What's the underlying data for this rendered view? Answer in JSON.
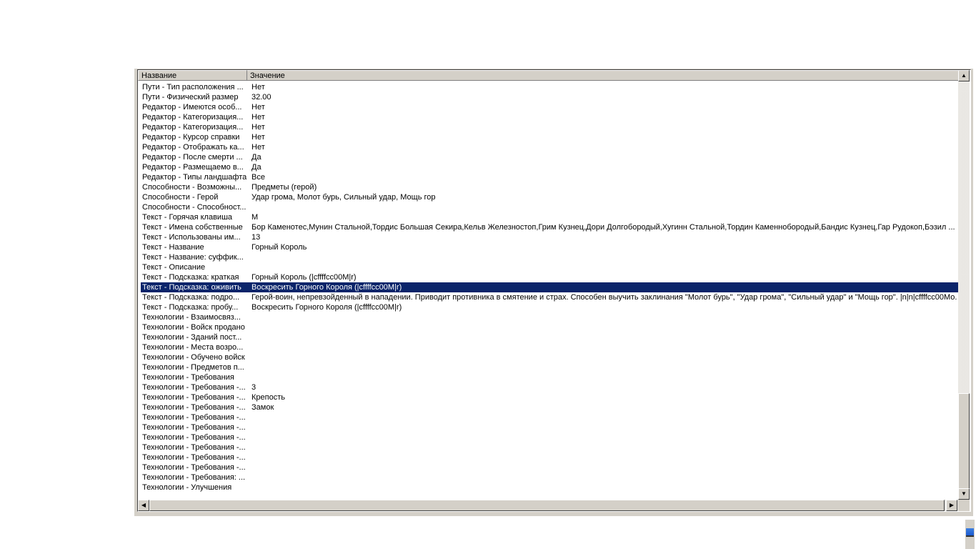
{
  "columns": {
    "name": "Название",
    "value": "Значение"
  },
  "selected_index": 20,
  "rows": [
    {
      "name": "Пути - Тип расположения ...",
      "value": "Нет"
    },
    {
      "name": "Пути - Физический размер",
      "value": "32.00"
    },
    {
      "name": "Редактор - Имеются особ...",
      "value": "Нет"
    },
    {
      "name": "Редактор - Категоризация...",
      "value": "Нет"
    },
    {
      "name": "Редактор - Категоризация...",
      "value": "Нет"
    },
    {
      "name": "Редактор - Курсор справки",
      "value": "Нет"
    },
    {
      "name": "Редактор - Отображать ка...",
      "value": "Нет"
    },
    {
      "name": "Редактор - После смерти ...",
      "value": "Да"
    },
    {
      "name": "Редактор - Размещаемо в...",
      "value": "Да"
    },
    {
      "name": "Редактор - Типы ландшафта",
      "value": "Все"
    },
    {
      "name": "Способности - Возможны...",
      "value": "Предметы (герой)"
    },
    {
      "name": "Способности - Герой",
      "value": "Удар грома, Молот бурь, Сильный удар, Мощь гор"
    },
    {
      "name": "Способности - Способност...",
      "value": ""
    },
    {
      "name": "Текст - Горячая клавиша",
      "value": "M"
    },
    {
      "name": "Текст - Имена собственные",
      "value": "Бор Каменотес,Мунин Стальной,Тордис Большая Секира,Кельв Железностоп,Грим Кузнец,Дори Долгобородый,Хугинн Стальной,Тордин Каменнобородый,Бандис Кузнец,Гар Рудокоп,Бэзил ..."
    },
    {
      "name": "Текст - Использованы им...",
      "value": "13"
    },
    {
      "name": "Текст - Название",
      "value": "Горный Король"
    },
    {
      "name": "Текст - Название: суффик...",
      "value": ""
    },
    {
      "name": "Текст - Описание",
      "value": ""
    },
    {
      "name": "Текст - Подсказка: краткая",
      "value": "Горный Король (|cffffcc00M|r)"
    },
    {
      "name": "Текст - Подсказка: оживить",
      "value": "Воскресить Горного Короля (|cffffcc00M|r)"
    },
    {
      "name": "Текст - Подсказка: подро...",
      "value": "Герой-воин, непревзойденный в нападении. Приводит противника в смятение и страх. Способен выучить заклинания \"Молот бурь\", \"Удар грома\", \"Сильный удар\" и \"Мощь гор\". |n|n|cffffcc00Мо..."
    },
    {
      "name": "Текст - Подсказка: пробу...",
      "value": "Воскресить Горного Короля (|cffffcc00M|r)"
    },
    {
      "name": "Технологии - Взаимосвяз...",
      "value": ""
    },
    {
      "name": "Технологии - Войск продано",
      "value": ""
    },
    {
      "name": "Технологии - Зданий пост...",
      "value": ""
    },
    {
      "name": "Технологии - Места возро...",
      "value": ""
    },
    {
      "name": "Технологии - Обучено войск",
      "value": ""
    },
    {
      "name": "Технологии - Предметов п...",
      "value": ""
    },
    {
      "name": "Технологии - Требования",
      "value": ""
    },
    {
      "name": "Технологии - Требования -...",
      "value": "3"
    },
    {
      "name": "Технологии - Требования -...",
      "value": "Крепость"
    },
    {
      "name": "Технологии - Требования -...",
      "value": "Замок"
    },
    {
      "name": "Технологии - Требования -...",
      "value": ""
    },
    {
      "name": "Технологии - Требования -...",
      "value": ""
    },
    {
      "name": "Технологии - Требования -...",
      "value": ""
    },
    {
      "name": "Технологии - Требования -...",
      "value": ""
    },
    {
      "name": "Технологии - Требования -...",
      "value": ""
    },
    {
      "name": "Технологии - Требования -...",
      "value": ""
    },
    {
      "name": "Технологии - Требования: ...",
      "value": ""
    },
    {
      "name": "Технологии - Улучшения",
      "value": ""
    }
  ],
  "colors": {
    "selection": "#0a246a",
    "chrome": "#d4d0c8"
  }
}
